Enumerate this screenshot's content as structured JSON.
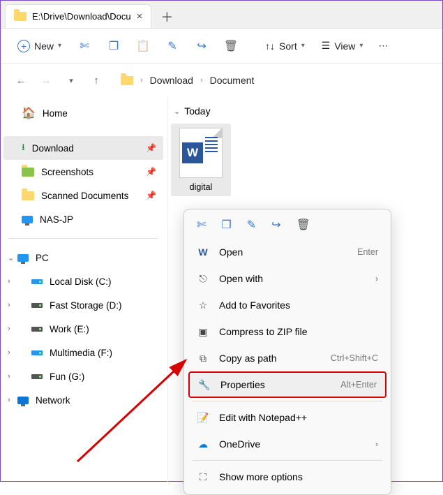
{
  "tab": {
    "title": "E:\\Drive\\Download\\Docu"
  },
  "toolbar": {
    "new": "New",
    "sort": "Sort",
    "view": "View"
  },
  "breadcrumb": [
    "Download",
    "Document"
  ],
  "sidebar": {
    "home": "Home",
    "quick": [
      {
        "label": "Download",
        "icon": "download"
      },
      {
        "label": "Screenshots",
        "icon": "folder-green"
      },
      {
        "label": "Scanned Documents",
        "icon": "folder"
      },
      {
        "label": "NAS-JP",
        "icon": "monitor"
      }
    ],
    "pc": "PC",
    "drives": [
      "Local Disk (C:)",
      "Fast Storage (D:)",
      "Work (E:)",
      "Multimedia (F:)",
      "Fun (G:)"
    ],
    "network": "Network"
  },
  "group": "Today",
  "file": {
    "name": "digital"
  },
  "context": {
    "open": "Open",
    "open_kbd": "Enter",
    "open_with": "Open with",
    "fav": "Add to Favorites",
    "zip": "Compress to ZIP file",
    "copy_path": "Copy as path",
    "copy_path_kbd": "Ctrl+Shift+C",
    "props": "Properties",
    "props_kbd": "Alt+Enter",
    "notepad": "Edit with Notepad++",
    "onedrive": "OneDrive",
    "more": "Show more options"
  }
}
